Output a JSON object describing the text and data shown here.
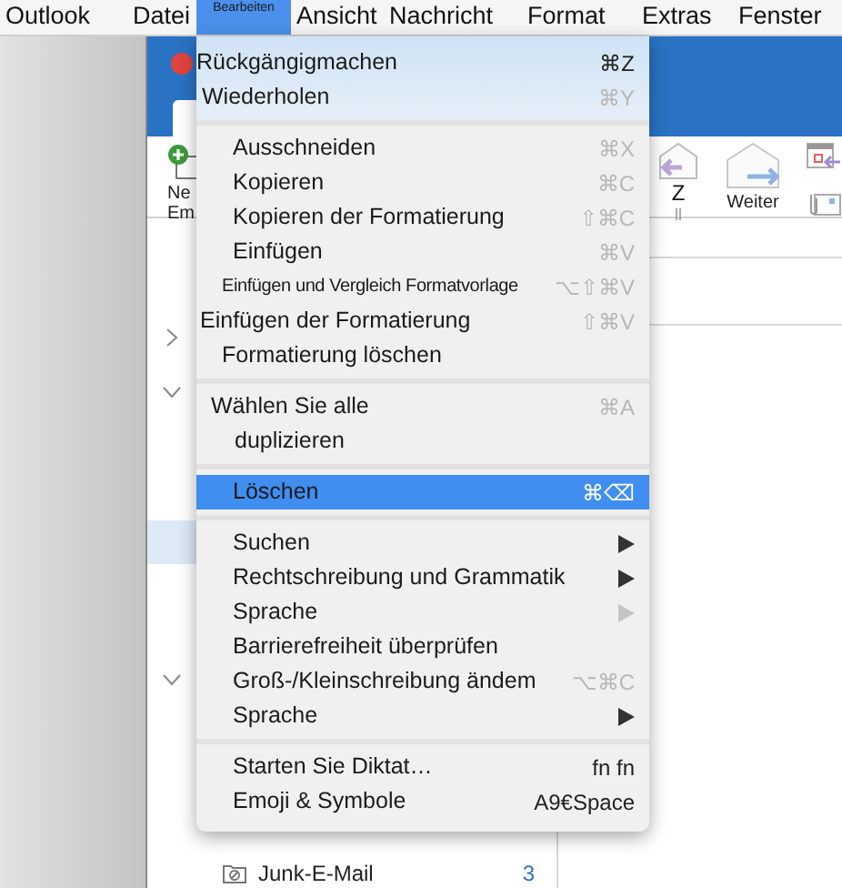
{
  "menu_bar": [
    {
      "label": "Outlook",
      "selected": false
    },
    {
      "label": "Datei",
      "selected": false
    },
    {
      "label": "Bearbeiten",
      "selected": true
    },
    {
      "label": "Ansicht",
      "selected": false
    },
    {
      "label": "Nachricht",
      "selected": false
    },
    {
      "label": "Format",
      "selected": false
    },
    {
      "label": "Extras",
      "selected": false
    },
    {
      "label": "Fenster",
      "selected": false
    }
  ],
  "ribbon": {
    "new_email": [
      "Ne",
      "Em"
    ],
    "reply_all": [
      "Z",
      "ll"
    ],
    "forward": "Weiter"
  },
  "folders": [
    {
      "name": "Junk-E-Mail",
      "count": "3"
    }
  ],
  "menu": {
    "groups": [
      {
        "items": [
          {
            "kind": "command",
            "label": "Rückgängigmachen",
            "shortcut": "⌘Z",
            "dimmed": false,
            "selected": false
          },
          {
            "kind": "command",
            "label": "Wiederholen",
            "shortcut": "⌘Y",
            "dimmed": true,
            "selected": false
          }
        ]
      },
      {
        "items": [
          {
            "kind": "command",
            "label": "Ausschneiden",
            "shortcut": "⌘X",
            "dimmed": true,
            "selected": false
          },
          {
            "kind": "command",
            "label": "Kopieren",
            "shortcut": "⌘C",
            "dimmed": true,
            "selected": false
          },
          {
            "kind": "command",
            "label": "Kopieren der Formatierung",
            "shortcut": "⇧⌘C",
            "dimmed": true,
            "selected": false
          },
          {
            "kind": "command",
            "label": "Einfügen",
            "shortcut": "⌘V",
            "dimmed": true,
            "selected": false
          },
          {
            "kind": "command",
            "label": "Einfügen und Vergleich Formatvorlage",
            "shortcut": "⌥⇧⌘V",
            "dimmed": true,
            "selected": false
          },
          {
            "kind": "command",
            "label": "Einfügen der Formatierung",
            "shortcut": "⇧⌘V",
            "dimmed": true,
            "selected": false
          },
          {
            "kind": "command",
            "label": "Formatierung löschen",
            "selected": false
          }
        ]
      },
      {
        "items": [
          {
            "kind": "command",
            "label": "Wählen Sie alle",
            "shortcut": "⌘A",
            "dimmed": true,
            "selected": false
          },
          {
            "kind": "command",
            "label": "duplizieren",
            "selected": false
          }
        ]
      },
      {
        "items": [
          {
            "kind": "command",
            "label": "Löschen",
            "shortcut": "⌘⌫",
            "selected": true
          }
        ]
      },
      {
        "items": [
          {
            "kind": "submenu",
            "label": "Suchen",
            "dimmed": false,
            "selected": false
          },
          {
            "kind": "submenu",
            "label": "Rechtschreibung und Grammatik",
            "dimmed": false,
            "selected": false
          },
          {
            "kind": "submenu",
            "label": "Sprache",
            "dimmed": true,
            "selected": false
          },
          {
            "kind": "command",
            "label": "Barrierefreiheit überprüfen",
            "selected": false
          },
          {
            "kind": "command",
            "label": "Groß-/Kleinschreibung ändem",
            "shortcut": "⌥⌘C",
            "dimmed": true,
            "selected": false
          },
          {
            "kind": "submenu",
            "label": "Sprache",
            "dimmed": false,
            "selected": false
          }
        ]
      },
      {
        "items": [
          {
            "kind": "command",
            "label": "Starten Sie Diktat…",
            "shortcut": "fn fn",
            "dimmed": false,
            "selected": false
          },
          {
            "kind": "command",
            "label": "Emoji & Symbole",
            "shortcut": "A9€Space",
            "dimmed": false,
            "selected": false
          }
        ]
      }
    ]
  }
}
